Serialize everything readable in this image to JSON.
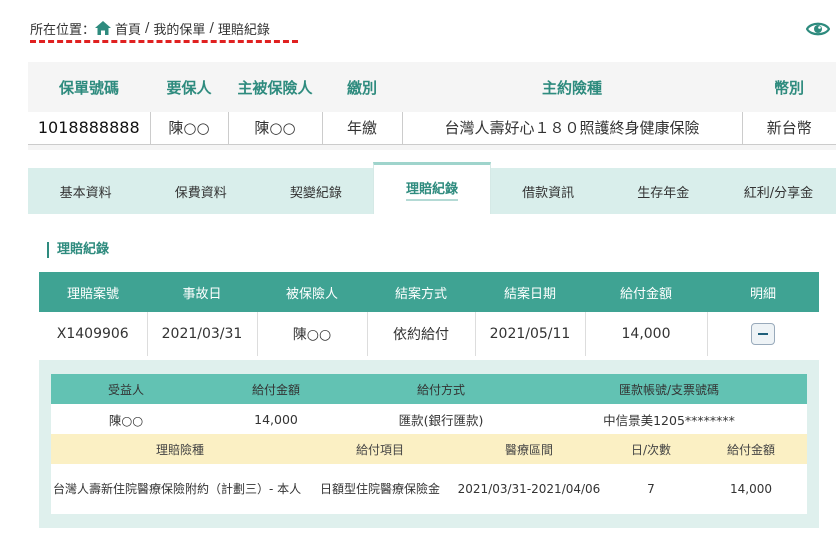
{
  "breadcrumb": {
    "label": "所在位置：",
    "items": [
      "首頁",
      "我的保單",
      "理賠紀錄"
    ],
    "sep": "/"
  },
  "policy": {
    "headers": [
      "保單號碼",
      "要保人",
      "主被保險人",
      "繳別",
      "主約險種",
      "幣別"
    ],
    "row": [
      "1018888888",
      "陳○○",
      "陳○○",
      "年繳",
      "台灣人壽好心１８０照護終身健康保險",
      "新台幣"
    ]
  },
  "tabs": [
    {
      "label": "基本資料"
    },
    {
      "label": "保費資料"
    },
    {
      "label": "契變紀錄"
    },
    {
      "label": "理賠紀錄"
    },
    {
      "label": "借款資訊"
    },
    {
      "label": "生存年金"
    },
    {
      "label": "紅利/分享金"
    }
  ],
  "active_tab": "理賠紀錄",
  "section": {
    "title": "理賠紀錄"
  },
  "claims": {
    "headers": [
      "理賠案號",
      "事故日",
      "被保險人",
      "結案方式",
      "結案日期",
      "給付金額",
      "明細"
    ],
    "rows": [
      [
        "X1409906",
        "2021/03/31",
        "陳○○",
        "依約給付",
        "2021/05/11",
        "14,000"
      ]
    ]
  },
  "payment": {
    "headers": [
      "受益人",
      "給付金額",
      "給付方式",
      "匯款帳號/支票號碼"
    ],
    "row": [
      "陳○○",
      "14,000",
      "匯款(銀行匯款)",
      "中信景美1205********"
    ]
  },
  "items": {
    "headers": [
      "理賠險種",
      "給付項目",
      "醫療區間",
      "日/次數",
      "給付金額"
    ],
    "row": [
      "台灣人壽新住院醫療保險附約（計劃三）- 本人",
      "日額型住院醫療保險金",
      "2021/03/31-2021/04/06",
      "7",
      "14,000"
    ]
  },
  "colors": {
    "accent": "#2e8b7e",
    "table_header": "#3fa393",
    "tab_bg": "#d9eeeb",
    "detail_bg": "#dff0ed",
    "yellow_header": "#fbf0c4",
    "breadcrumb_dash": "#e02020"
  },
  "icons": {
    "home": "home-icon",
    "eye": "eye-icon",
    "collapse": "minus-icon"
  }
}
